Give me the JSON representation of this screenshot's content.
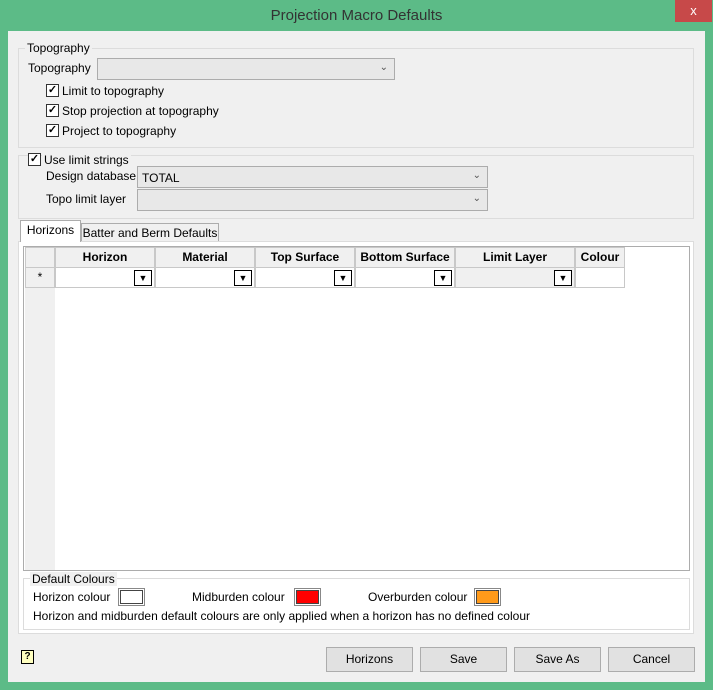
{
  "window": {
    "title": "Projection Macro Defaults",
    "close": "x"
  },
  "topography": {
    "group_label": "Topography",
    "field_label": "Topography",
    "value": "",
    "checkboxes": [
      {
        "label": "Limit to topography",
        "checked": true
      },
      {
        "label": "Stop projection at topography",
        "checked": true
      },
      {
        "label": "Project to topography",
        "checked": true
      }
    ]
  },
  "limits": {
    "use_limit_strings": {
      "label": "Use limit strings",
      "checked": true
    },
    "design_database_label": "Design database",
    "design_database_value": "TOTAL",
    "topo_limit_layer_label": "Topo limit layer",
    "topo_limit_layer_value": ""
  },
  "tabs": [
    {
      "label": "Horizons",
      "active": true
    },
    {
      "label": "Batter and Berm Defaults",
      "active": false
    }
  ],
  "grid": {
    "columns": [
      "Horizon",
      "Material",
      "Top Surface",
      "Bottom Surface",
      "Limit Layer",
      "Colour"
    ],
    "new_row_marker": "*"
  },
  "default_colours": {
    "group_label": "Default Colours",
    "horizon_label": "Horizon colour",
    "horizon_color": "#ffffff",
    "midburden_label": "Midburden colour",
    "midburden_color": "#ff0000",
    "overburden_label": "Overburden colour",
    "overburden_color": "#ff9a1a",
    "note": "Horizon and midburden default colours are only applied when a horizon has no defined colour"
  },
  "buttons": {
    "horizons": "Horizons",
    "save": "Save",
    "save_as": "Save As",
    "cancel": "Cancel",
    "help": "?"
  }
}
